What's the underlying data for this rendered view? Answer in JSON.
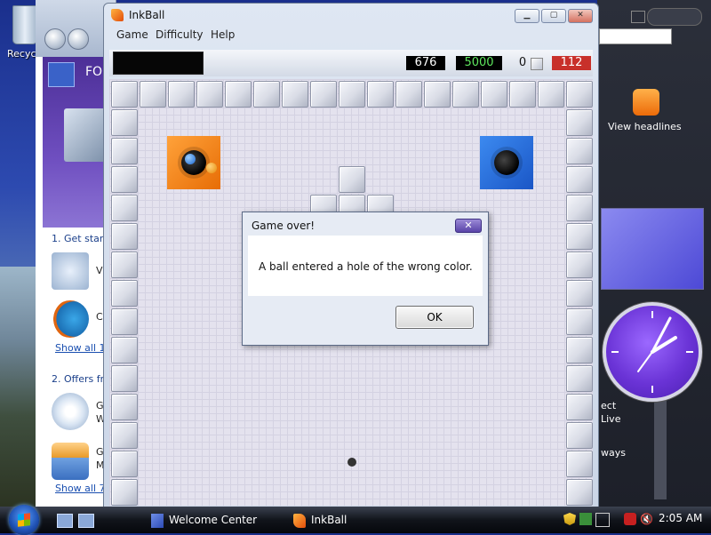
{
  "desktop": {
    "recycle_label": "Recyc"
  },
  "welcome_center": {
    "hero_title": "FOR",
    "section1": "1. Get start",
    "item1": "V",
    "item2": "C",
    "show_all_1": "Show all 1",
    "section2": "2. Offers fr",
    "item3a": "G",
    "item3b": "W",
    "item4a": "G",
    "item4b": "M",
    "show_all_7": "Show all 7"
  },
  "sidebar": {
    "feeds_label": "View headlines",
    "txt1": "ect",
    "txt2": "Live",
    "txt3": "ways"
  },
  "inkball": {
    "title": "InkBall",
    "menu": [
      "Game",
      "Difficulty",
      "Help"
    ],
    "score": "676",
    "target": "5000",
    "balls_label": "0",
    "time": "112",
    "colors": {
      "orange": "#f08a1c",
      "blue": "#2a6fdc",
      "wall": "#dfe2ea"
    }
  },
  "dialog": {
    "title": "Game over!",
    "message": "A ball entered a hole of the wrong color.",
    "ok": "OK",
    "close": "✕"
  },
  "taskbar": {
    "items": [
      "Welcome Center",
      "InkBall"
    ],
    "time": "2:05 AM"
  }
}
